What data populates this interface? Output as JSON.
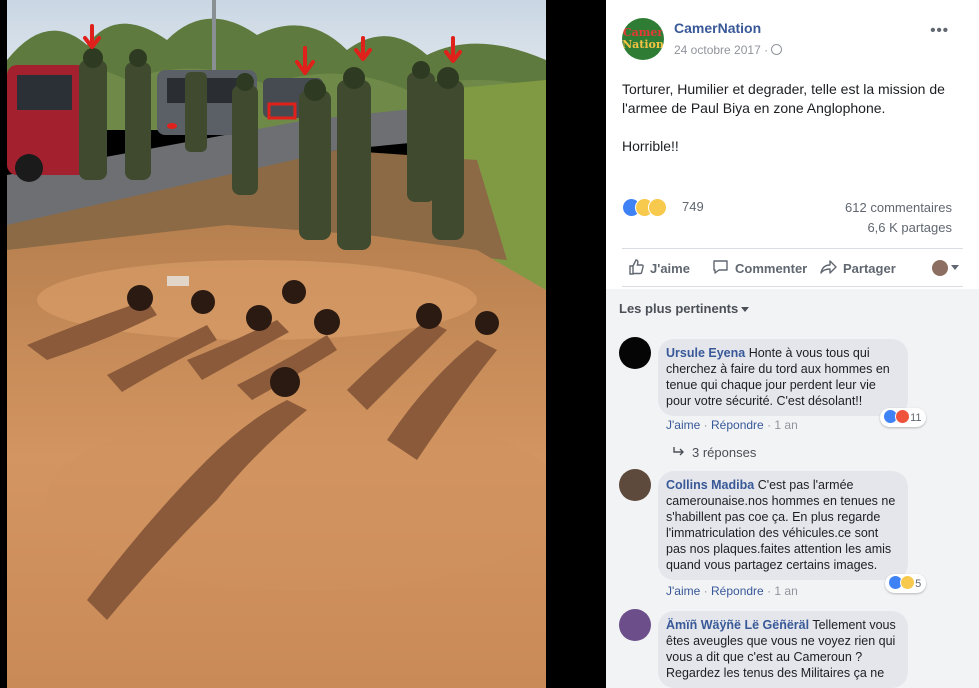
{
  "post": {
    "page_name": "CamerNation",
    "logo_text_line1": "Camer",
    "logo_text_line2": "Nation",
    "date": "24 octobre 2017 ·",
    "text_line1": "Torturer, Humilier et degrader, telle est la mission de l'armee de Paul Biya en zone Anglophone.",
    "text_line2": "Horrible!!",
    "reaction_count": "749",
    "comments_count": "612 commentaires",
    "shares_count": "6,6 K partages"
  },
  "actions": {
    "like": "J'aime",
    "comment": "Commenter",
    "share": "Partager"
  },
  "comments_section": {
    "sort_label": "Les plus pertinents",
    "items": [
      {
        "author": "Ursule Eyena",
        "text": "Honte à vous tous qui cherchez à faire du tord aux hommes en tenue qui chaque jour perdent leur vie pour votre sécurité. C'est désolant!!",
        "like": "J'aime",
        "reply": "Répondre",
        "time": "1 an",
        "reactions": "11",
        "replies": "3 réponses"
      },
      {
        "author": "Collins Madiba",
        "text": "C'est pas l'armée camerounaise.nos hommes en tenues ne s'habillent pas coe ça. En plus regarde l'immatriculation des véhicules.ce sont pas nos plaques.faites attention les amis quand vous partagez certains images.",
        "like": "J'aime",
        "reply": "Répondre",
        "time": "1 an",
        "reactions": "5"
      },
      {
        "author": "Ämïñ Wäÿñë Lë Gëñëräl",
        "text": "Tellement vous êtes aveugles que vous ne voyez rien qui vous a dit que c'est au Cameroun ? Regardez les tenus des Militaires ça ne"
      }
    ]
  },
  "colors": {
    "link_blue": "#385898",
    "like_blue": "#3f82f5",
    "arrow_red": "#e0201a",
    "mud": "#c98a57"
  }
}
